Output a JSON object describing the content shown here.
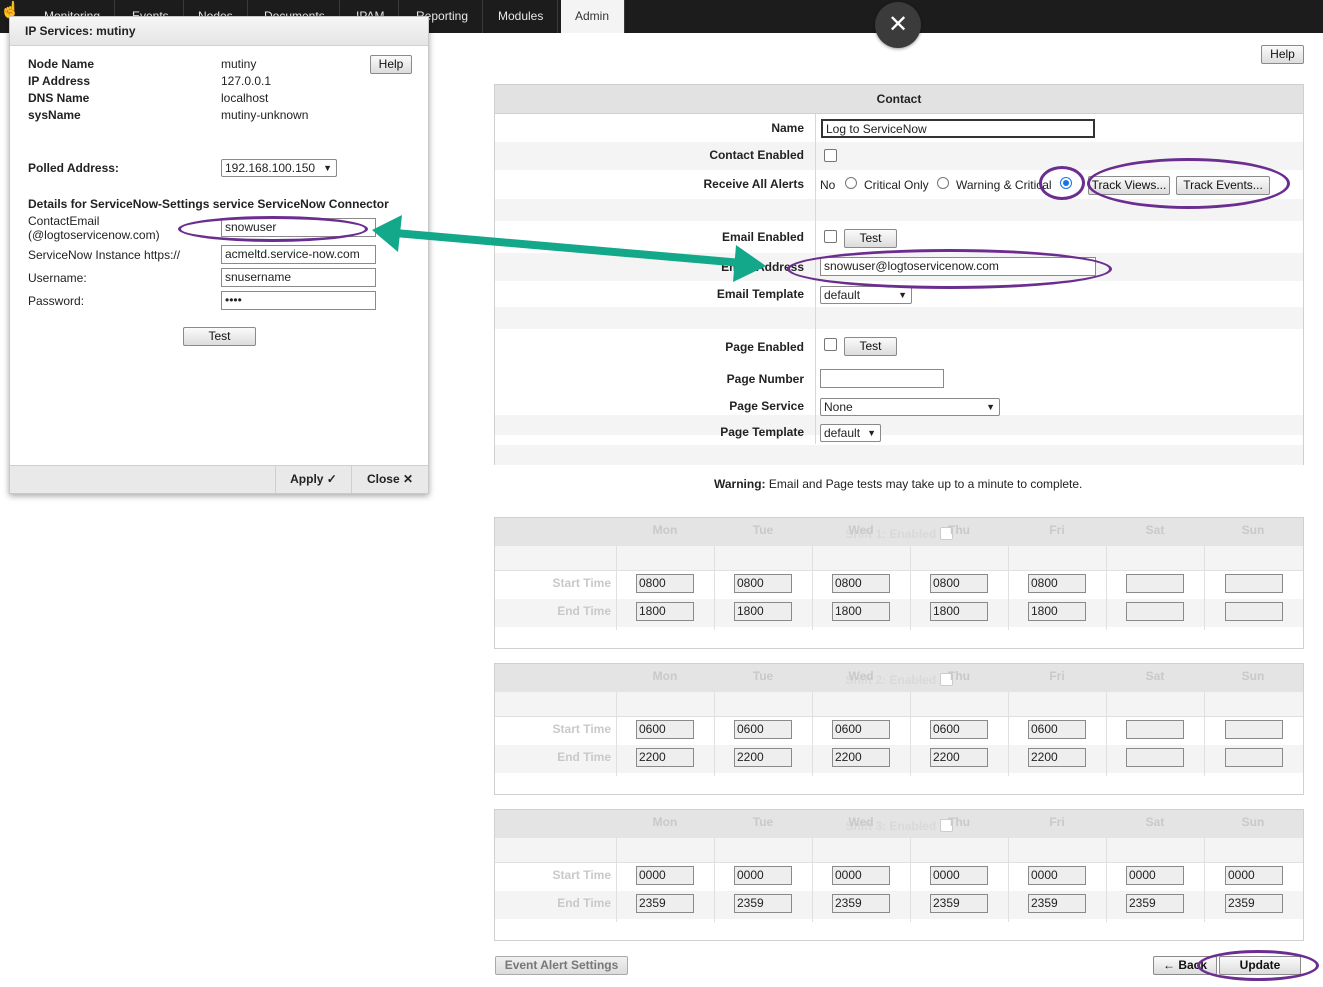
{
  "nav": {
    "tabs": [
      "Monitoring",
      "Events",
      "Nodes",
      "Documents",
      "IPAM",
      "Reporting",
      "Modules",
      "Admin"
    ],
    "active": "Admin"
  },
  "overlay_close_glyph": "✕",
  "dialog": {
    "title": "IP Services: mutiny",
    "help": "Help",
    "node_name_label": "Node Name",
    "node_name": "mutiny",
    "ip_label": "IP Address",
    "ip": "127.0.0.1",
    "dns_label": "DNS Name",
    "dns": "localhost",
    "sysname_label": "sysName",
    "sysname": "mutiny-unknown",
    "polled_label": "Polled Address:",
    "polled": "192.168.100.150",
    "details_heading": "Details for ServiceNow-Settings service ServiceNow Connector",
    "contact_email_label_1": "ContactEmail",
    "contact_email_label_2": "(@logtoservicenow.com)",
    "contact_email": "snowuser",
    "instance_label": "ServiceNow Instance https://",
    "instance": "acmeltd.service-now.com",
    "username_label": "Username:",
    "username": "snusername",
    "password_label": "Password:",
    "password": "••••",
    "test": "Test",
    "apply": "Apply ✓",
    "close": "Close ✕"
  },
  "page_help": "Help",
  "contact": {
    "title": "Contact",
    "name_label": "Name",
    "name": "Log to ServiceNow",
    "enabled_label": "Contact Enabled",
    "receive_label": "Receive All Alerts",
    "opt_no": "No",
    "opt_critical": "Critical Only",
    "opt_warning": "Warning & Critical",
    "track_views": "Track Views...",
    "track_events": "Track Events...",
    "email_enabled_label": "Email Enabled",
    "email_test": "Test",
    "email_address_label": "Email Address",
    "email_address": "snowuser@logtoservicenow.com",
    "email_template_label": "Email Template",
    "email_template": "default",
    "page_enabled_label": "Page Enabled",
    "page_test": "Test",
    "page_number_label": "Page Number",
    "page_number": "",
    "page_service_label": "Page Service",
    "page_service": "None",
    "page_template_label": "Page Template",
    "page_template": "default"
  },
  "warning": {
    "strong": "Warning:",
    "text": "Email and Page tests may take up to a minute to complete."
  },
  "days": [
    "Mon",
    "Tue",
    "Wed",
    "Thu",
    "Fri",
    "Sat",
    "Sun"
  ],
  "start_label": "Start Time",
  "end_label": "End Time",
  "shifts": [
    {
      "title": "Shift 1: Enabled",
      "start": [
        "0800",
        "0800",
        "0800",
        "0800",
        "0800",
        "",
        ""
      ],
      "end": [
        "1800",
        "1800",
        "1800",
        "1800",
        "1800",
        "",
        ""
      ]
    },
    {
      "title": "Shift 2: Enabled",
      "start": [
        "0600",
        "0600",
        "0600",
        "0600",
        "0600",
        "",
        ""
      ],
      "end": [
        "2200",
        "2200",
        "2200",
        "2200",
        "2200",
        "",
        ""
      ]
    },
    {
      "title": "Shift 3: Enabled",
      "start": [
        "0000",
        "0000",
        "0000",
        "0000",
        "0000",
        "0000",
        "0000"
      ],
      "end": [
        "2359",
        "2359",
        "2359",
        "2359",
        "2359",
        "2359",
        "2359"
      ]
    }
  ],
  "footer": {
    "event_alert": "Event Alert Settings",
    "back": "← Back",
    "update": "Update"
  },
  "colors": {
    "annotation": "#6b2d8f",
    "arrow": "#13a88a",
    "radio": "#1a73e8"
  }
}
